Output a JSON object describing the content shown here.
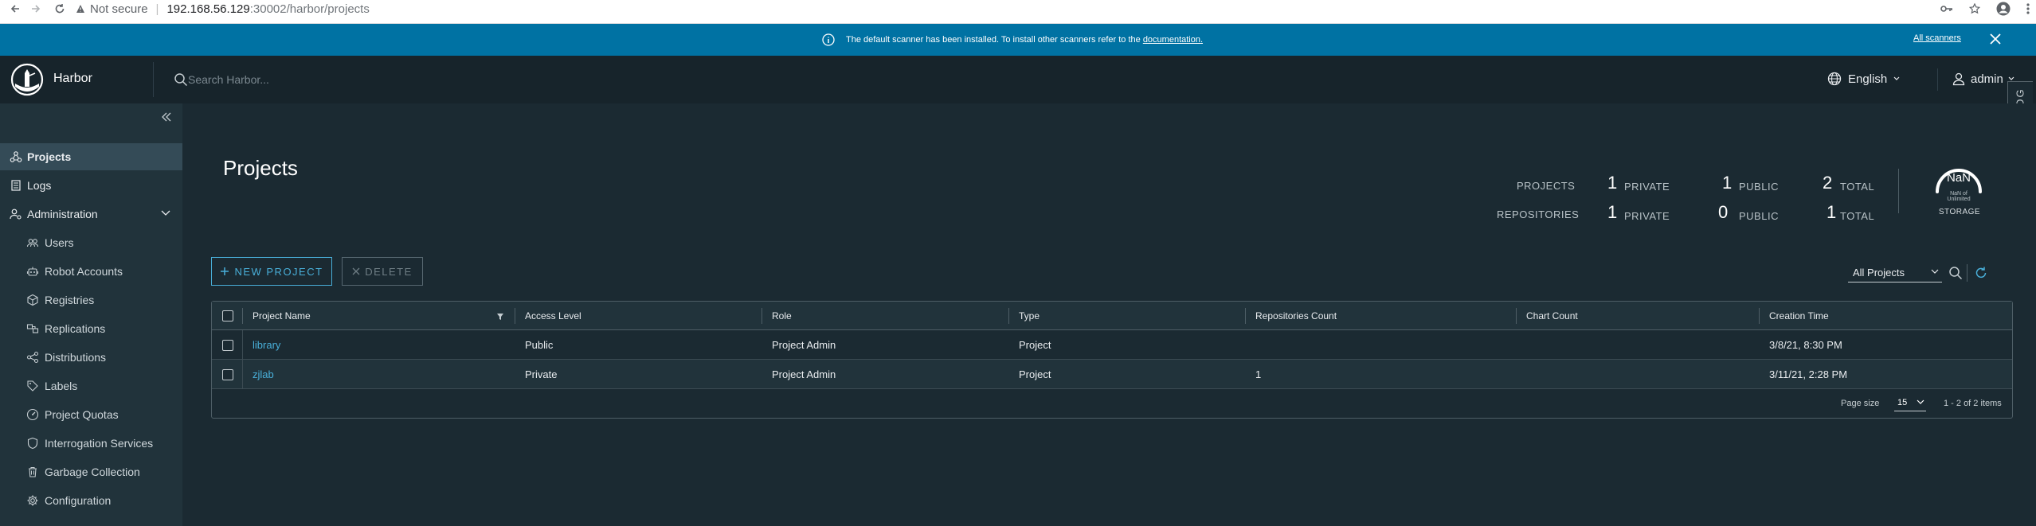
{
  "browser": {
    "security_label": "Not secure",
    "url_host": "192.168.56.129",
    "url_path": ":30002/harbor/projects"
  },
  "banner": {
    "message": "The default scanner has been installed. To install other scanners refer to the",
    "link": "documentation.",
    "action": "All scanners"
  },
  "header": {
    "app_name": "Harbor",
    "search_placeholder": "Search Harbor...",
    "language": "English",
    "user": "admin",
    "event_log": "EVENT LOG"
  },
  "sidebar": {
    "items": [
      {
        "label": "Projects",
        "icon": "projects-icon",
        "active": true
      },
      {
        "label": "Logs",
        "icon": "logs-icon"
      },
      {
        "label": "Administration",
        "icon": "administration-icon"
      }
    ],
    "admin_items": [
      {
        "label": "Users",
        "icon": "users-icon"
      },
      {
        "label": "Robot Accounts",
        "icon": "robot-icon"
      },
      {
        "label": "Registries",
        "icon": "registries-icon"
      },
      {
        "label": "Replications",
        "icon": "replications-icon"
      },
      {
        "label": "Distributions",
        "icon": "distributions-icon"
      },
      {
        "label": "Labels",
        "icon": "labels-icon"
      },
      {
        "label": "Project Quotas",
        "icon": "quotas-icon"
      },
      {
        "label": "Interrogation Services",
        "icon": "shield-icon"
      },
      {
        "label": "Garbage Collection",
        "icon": "trash-icon"
      },
      {
        "label": "Configuration",
        "icon": "gear-icon"
      }
    ]
  },
  "main": {
    "title": "Projects",
    "stats": {
      "projects_label": "PROJECTS",
      "repositories_label": "REPOSITORIES",
      "private_label": "PRIVATE",
      "public_label": "PUBLIC",
      "total_label": "TOTAL",
      "projects": {
        "private": "1",
        "public": "1",
        "total": "2"
      },
      "repositories": {
        "private": "1",
        "public": "0",
        "total": "1"
      },
      "storage_value": "NaN",
      "storage_sub": "NaN of Unlimited",
      "storage_label": "STORAGE"
    },
    "new_project_label": "NEW PROJECT",
    "delete_label": "DELETE",
    "filter_value": "All Projects",
    "table": {
      "columns": [
        "Project Name",
        "Access Level",
        "Role",
        "Type",
        "Repositories Count",
        "Chart Count",
        "Creation Time"
      ],
      "rows": [
        {
          "name": "library",
          "access": "Public",
          "role": "Project Admin",
          "type": "Project",
          "repo_count": "",
          "chart_count": "",
          "created": "3/8/21, 8:30 PM"
        },
        {
          "name": "zjlab",
          "access": "Private",
          "role": "Project Admin",
          "type": "Project",
          "repo_count": "1",
          "chart_count": "",
          "created": "3/11/21, 2:28 PM"
        }
      ],
      "page_size_label": "Page size",
      "page_size": "15",
      "page_info": "1 - 2 of 2 items"
    }
  },
  "colors": {
    "banner": "#0072a3",
    "header": "#17242b",
    "sidebar": "#21333b",
    "main": "#1b2a32",
    "accent": "#49afd9"
  }
}
